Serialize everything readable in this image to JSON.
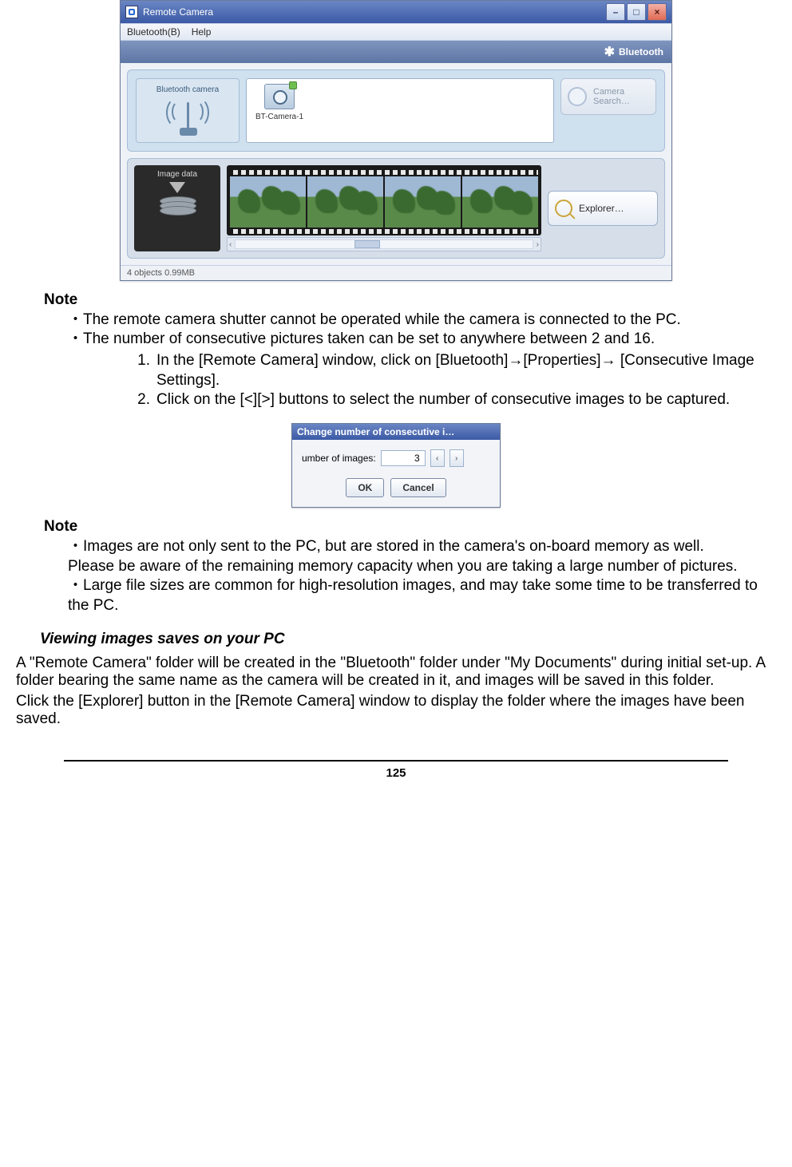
{
  "window": {
    "title": "Remote Camera",
    "menus": {
      "bluetooth": "Bluetooth(B)",
      "help": "Help"
    },
    "bluetooth_badge": "Bluetooth",
    "camera_panel_label": "Bluetooth camera",
    "camera_item_label": "BT-Camera-1",
    "camera_search_label": "Camera Search…",
    "image_data_label": "Image data",
    "explorer_label": "Explorer…",
    "statusbar": "4 objects  0.99MB",
    "scroll_left": "‹",
    "scroll_right": "›",
    "min_glyph": "–",
    "max_glyph": "□",
    "close_glyph": "×"
  },
  "dialog": {
    "title": "Change number of consecutive i…",
    "label": "umber of images:",
    "value": "3",
    "spin_left": "‹",
    "spin_right": "›",
    "ok": "OK",
    "cancel": "Cancel"
  },
  "text": {
    "note1_heading": "Note",
    "note1_b1": "・The remote camera shutter cannot be operated while the camera is connected to the PC.",
    "note1_b2": "・The number of consecutive pictures taken can be set to anywhere between 2 and 16.",
    "step1_num": "1.",
    "step1": "In the [Remote Camera] window, click on [Bluetooth]→[Properties]→ [Consecutive Image Settings].",
    "step2_num": "2.",
    "step2": "Click on the [<][>] buttons to select the number of consecutive images to be captured.",
    "note2_heading": "Note",
    "note2_b1": "・Images are not only sent to the PC, but are stored in the camera's on-board memory as well.",
    "note2_b1b": "Please be aware of the remaining memory capacity when you are taking a large number of pictures.",
    "note2_b2": "・Large file sizes are common for high-resolution images, and may take some time to be transferred to the PC.",
    "subheading": "Viewing images saves on your PC",
    "para1": "A \"Remote Camera\" folder will be created in the \"Bluetooth\" folder under \"My Documents\" during initial set-up. A folder bearing the same name as the camera will be created in it, and images will be saved in this folder.",
    "para2": "Click the [Explorer] button in the [Remote Camera] window to display the folder where the images have been saved."
  },
  "page_number": "125"
}
